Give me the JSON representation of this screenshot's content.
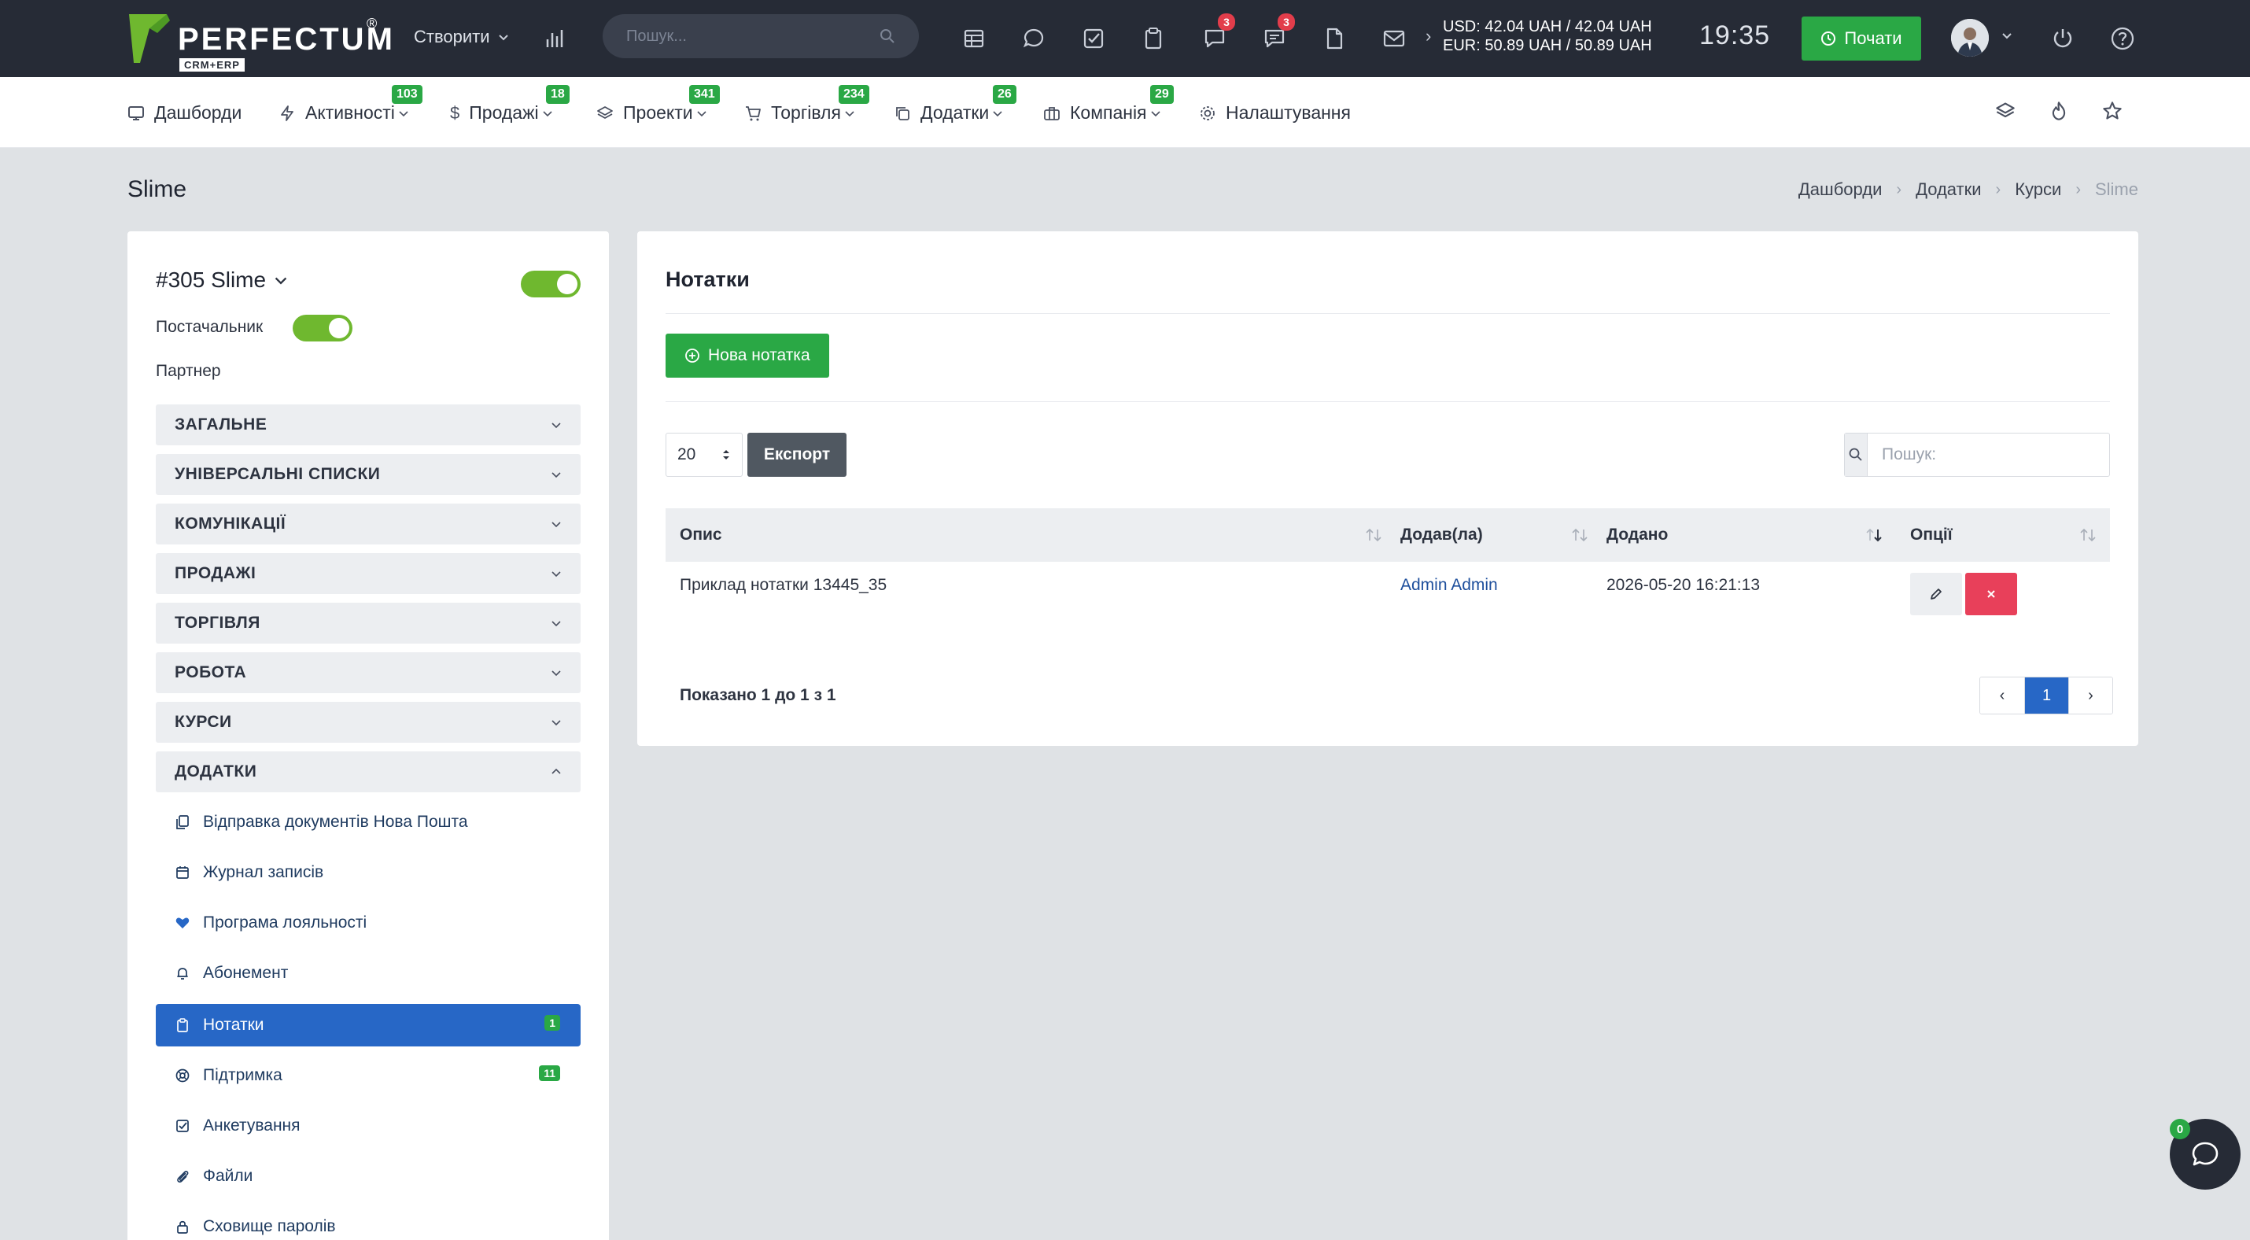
{
  "topbar": {
    "logo_text": "PERFECTUM",
    "logo_reg": "®",
    "logo_sub": "CRM+ERP",
    "create_label": "Створити",
    "search_placeholder": "Пошук...",
    "chat_badge": "3",
    "messages_badge": "3",
    "rate_usd": "USD: 42.04 UAH / 42.04 UAH",
    "rate_eur": "EUR: 50.89 UAH / 50.89 UAH",
    "clock": "19:35",
    "start_label": "Почати"
  },
  "nav": {
    "items": [
      {
        "label": "Дашборди",
        "badge": ""
      },
      {
        "label": "Активності",
        "badge": "103"
      },
      {
        "label": "Продажі",
        "badge": "18"
      },
      {
        "label": "Проекти",
        "badge": "341"
      },
      {
        "label": "Торгівля",
        "badge": "234"
      },
      {
        "label": "Додатки",
        "badge": "26"
      },
      {
        "label": "Компанія",
        "badge": "29"
      },
      {
        "label": "Налаштування",
        "badge": ""
      }
    ]
  },
  "page": {
    "title": "Slime",
    "breadcrumb": [
      "Дашборди",
      "Додатки",
      "Курси",
      "Slime"
    ]
  },
  "entity": {
    "title": "#305 Slime",
    "supplier_label": "Постачальник",
    "partner_label": "Партнер",
    "sections": [
      "ЗАГАЛЬНЕ",
      "УНІВЕРСАЛЬНІ СПИСКИ",
      "КОМУНІКАЦІЇ",
      "ПРОДАЖІ",
      "ТОРГІВЛЯ",
      "РОБОТА",
      "КУРСИ",
      "ДОДАТКИ"
    ],
    "addons": [
      {
        "label": "Відправка документів Нова Пошта",
        "count": ""
      },
      {
        "label": "Журнал записів",
        "count": ""
      },
      {
        "label": "Програма лояльності",
        "count": ""
      },
      {
        "label": "Абонемент",
        "count": ""
      },
      {
        "label": "Нотатки",
        "count": "1"
      },
      {
        "label": "Підтримка",
        "count": "11"
      },
      {
        "label": "Анкетування",
        "count": ""
      },
      {
        "label": "Файли",
        "count": ""
      },
      {
        "label": "Сховище паролів",
        "count": ""
      }
    ]
  },
  "notes": {
    "title": "Нотатки",
    "new_button": "Нова нотатка",
    "page_length": "20",
    "export_label": "Експорт",
    "search_placeholder": "Пошук:",
    "columns": [
      "Опис",
      "Додав(ла)",
      "Додано",
      "Опції"
    ],
    "rows": [
      {
        "description": "Приклад нотатки 13445_35",
        "author": "Admin Admin",
        "created": "2026-05-20 16:21:13"
      }
    ],
    "showing": "Показано 1 до 1 з 1",
    "current_page": "1"
  },
  "chat_widget": {
    "badge": "0"
  },
  "colors": {
    "topbar": "#262b36",
    "accent_green": "#2aa845",
    "active_blue": "#2767c6",
    "danger": "#e8405a",
    "background": "#dfe2e5"
  }
}
